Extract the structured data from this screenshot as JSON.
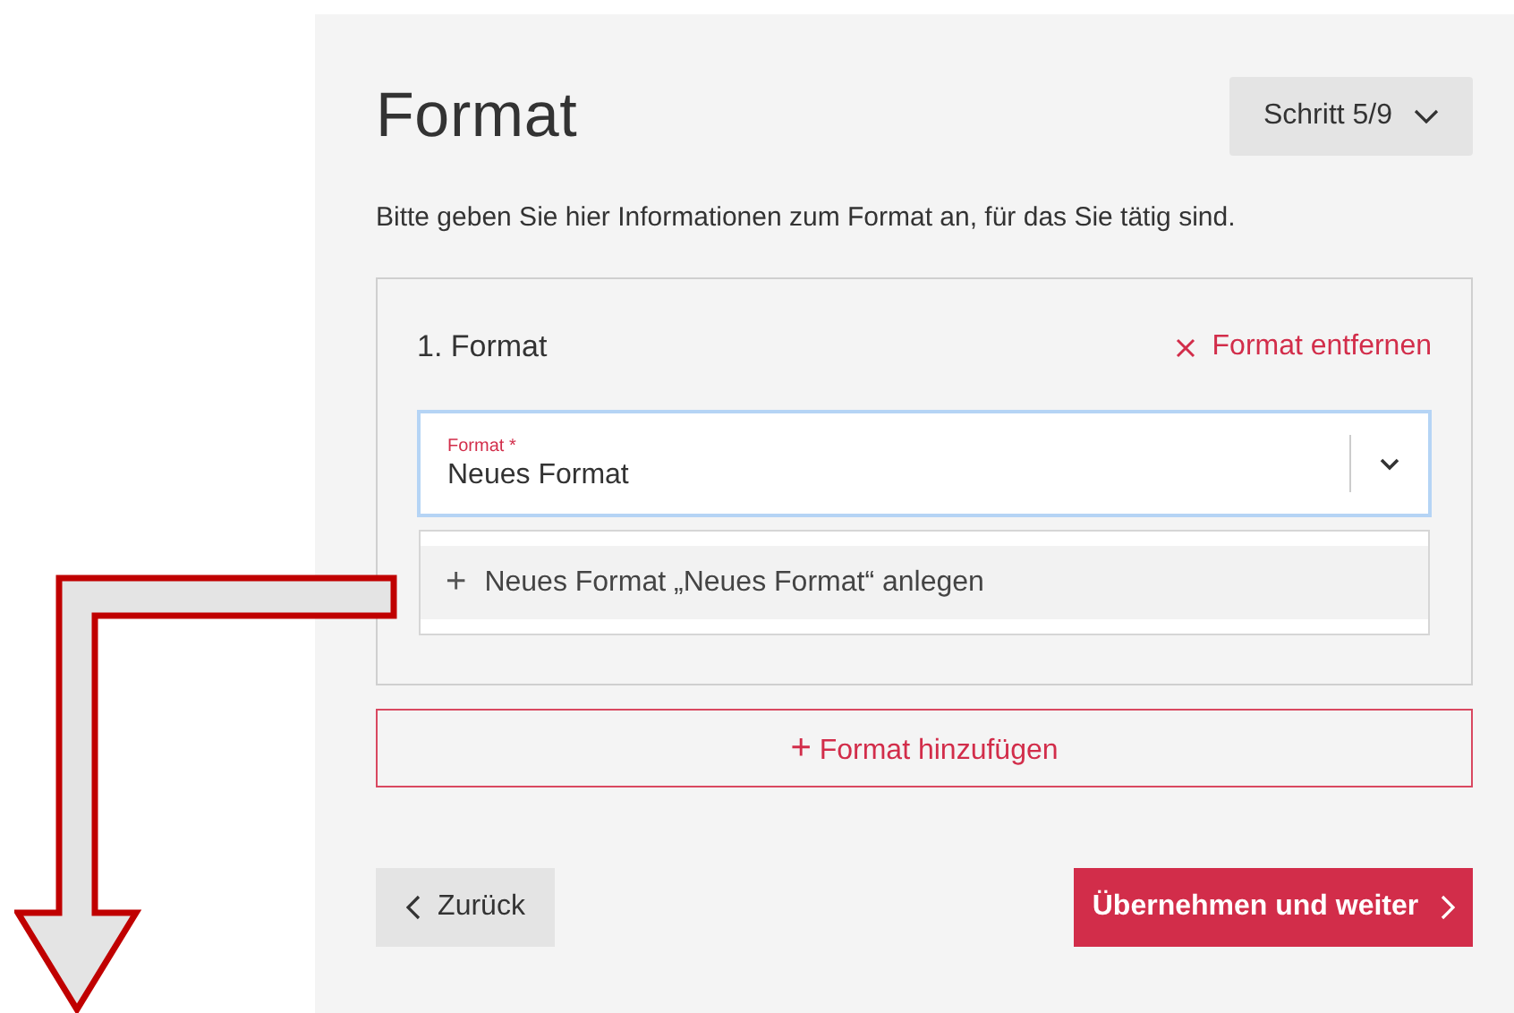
{
  "title": "Format",
  "step_button": {
    "label": "Schritt 5/9"
  },
  "description": "Bitte geben Sie hier Informationen zum Format an, für das Sie tätig sind.",
  "formats": [
    {
      "heading": "1. Format",
      "remove_label": "Format entfernen",
      "field": {
        "label": "Format *",
        "value": "Neues Format",
        "focused": true,
        "dropdown_open": true
      },
      "options": [
        {
          "icon": "+",
          "label": "Neues Format „Neues Format“ anlegen",
          "selected": true
        }
      ]
    }
  ],
  "add_button": {
    "icon": "+",
    "label": "Format hinzufügen"
  },
  "back_button": {
    "label": "Zurück"
  },
  "next_button": {
    "label": "Übernehmen und weiter"
  }
}
